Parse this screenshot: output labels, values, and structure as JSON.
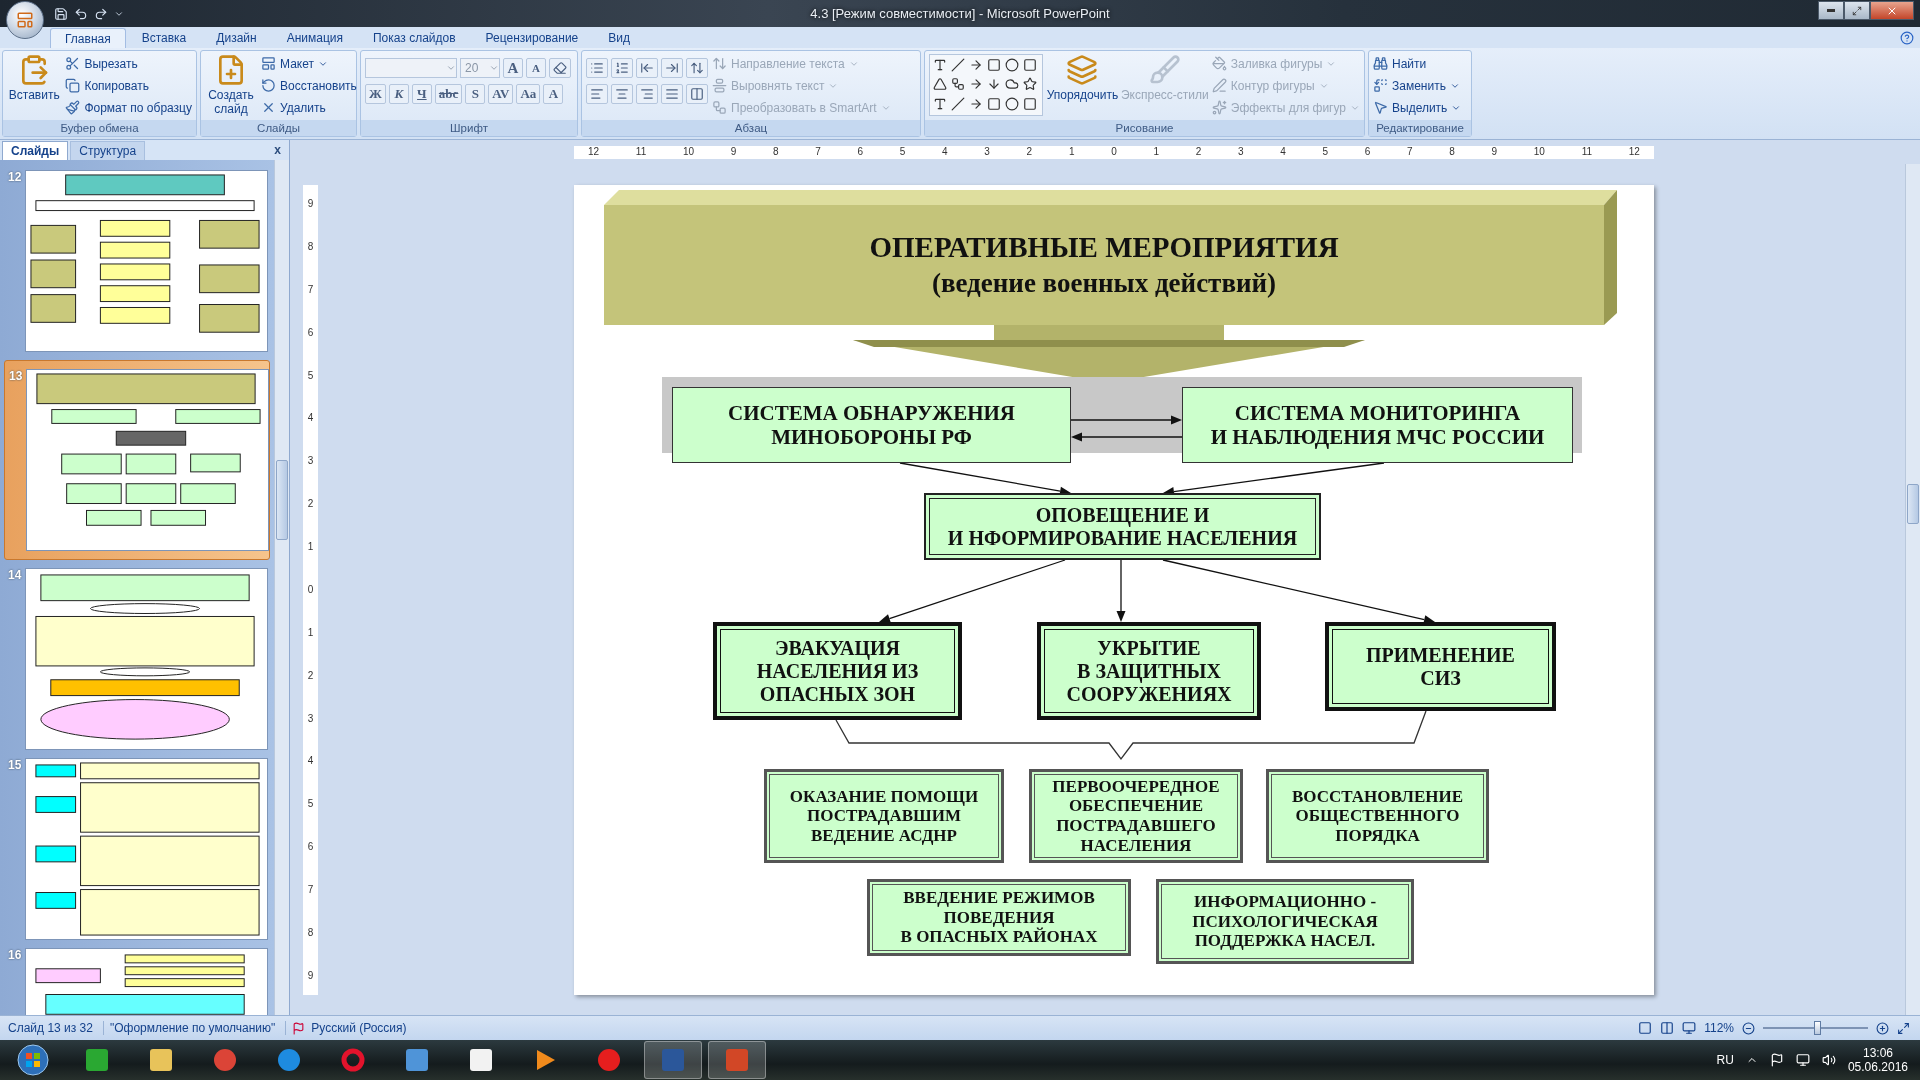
{
  "window": {
    "title": "4.3 [Режим совместимости] - Microsoft PowerPoint"
  },
  "ribbon": {
    "tabs": [
      {
        "label": "Главная",
        "selected": true
      },
      {
        "label": "Вставка",
        "selected": false
      },
      {
        "label": "Дизайн",
        "selected": false
      },
      {
        "label": "Анимация",
        "selected": false
      },
      {
        "label": "Показ слайдов",
        "selected": false
      },
      {
        "label": "Рецензирование",
        "selected": false
      },
      {
        "label": "Вид",
        "selected": false
      }
    ],
    "groups": [
      {
        "kind": "buttons",
        "title": "Буфер обмена",
        "large": [
          {
            "label": "Вставить",
            "disabled": false
          }
        ],
        "small": [
          {
            "label": "Вырезать",
            "disabled": false
          },
          {
            "label": "Копировать",
            "disabled": false
          },
          {
            "label": "Формат по образцу",
            "disabled": false
          }
        ]
      },
      {
        "kind": "buttons",
        "title": "Слайды",
        "large": [
          {
            "label": "Создать слайд",
            "disabled": false
          }
        ],
        "small": [
          {
            "label": "Макет",
            "disabled": false
          },
          {
            "label": "Восстановить",
            "disabled": false
          },
          {
            "label": "Удалить",
            "disabled": false
          }
        ]
      },
      {
        "kind": "font",
        "title": "Шрифт",
        "size_field": {
          "value": "20"
        },
        "size_buttons": [
          "A",
          "A"
        ],
        "format_buttons": [
          "Ж",
          "К",
          "Ч",
          "abc",
          "S",
          "AV",
          "Aa",
          "A"
        ]
      },
      {
        "kind": "paragraph",
        "title": "Абзац",
        "small": [
          {
            "label": "Направление текста",
            "disabled": true
          },
          {
            "label": "Выровнять текст",
            "disabled": true
          },
          {
            "label": "Преобразовать в SmartArt",
            "disabled": true
          }
        ]
      },
      {
        "kind": "drawing",
        "title": "Рисование",
        "large": [
          {
            "label": "Упорядочить",
            "disabled": false
          },
          {
            "label": "Экспресс-стили",
            "disabled": true
          }
        ],
        "small": [
          {
            "label": "Заливка фигуры",
            "disabled": true
          },
          {
            "label": "Контур фигуры",
            "disabled": true
          },
          {
            "label": "Эффекты для фигур",
            "disabled": true
          }
        ]
      },
      {
        "kind": "buttons",
        "title": "Редактирование",
        "small": [
          {
            "label": "Найти",
            "disabled": false
          },
          {
            "label": "Заменить",
            "disabled": false
          },
          {
            "label": "Выделить",
            "disabled": false
          }
        ]
      }
    ]
  },
  "panel": {
    "tabs": [
      {
        "label": "Слайды",
        "selected": true
      },
      {
        "label": "Структура",
        "selected": false
      }
    ],
    "close": "x",
    "thumbnails": [
      {
        "number": "12",
        "selected": false
      },
      {
        "number": "13",
        "selected": true
      },
      {
        "number": "14",
        "selected": false
      },
      {
        "number": "15",
        "selected": false
      },
      {
        "number": "16",
        "selected": false
      }
    ]
  },
  "ruler": {
    "horizontal": [
      "12",
      "11",
      "10",
      "9",
      "8",
      "7",
      "6",
      "5",
      "4",
      "3",
      "2",
      "1",
      "0",
      "1",
      "2",
      "3",
      "4",
      "5",
      "6",
      "7",
      "8",
      "9",
      "10",
      "11",
      "12"
    ],
    "vertical": [
      "9",
      "8",
      "7",
      "6",
      "5",
      "4",
      "3",
      "2",
      "1",
      "0",
      "1",
      "2",
      "3",
      "4",
      "5",
      "6",
      "7",
      "8",
      "9"
    ]
  },
  "slide": {
    "title": "ОПЕРАТИВНЫЕ МЕРОПРИЯТИЯ",
    "subtitle": "(ведение военных действий)",
    "nodes": [
      {
        "kind": "source",
        "lines": [
          "СИСТЕМА ОБНАРУЖЕНИЯ",
          "МИНОБОРОНЫ РФ"
        ]
      },
      {
        "kind": "source",
        "lines": [
          "СИСТЕМА МОНИТОРИНГА",
          "И НАБЛЮДЕНИЯ МЧС РОССИИ"
        ]
      },
      {
        "kind": "hub",
        "lines": [
          "ОПОВЕЩЕНИЕ И",
          "И НФОРМИРОВАНИЕ НАСЕЛЕНИЯ"
        ]
      },
      {
        "kind": "action",
        "lines": [
          "ЭВАКУАЦИЯ",
          "НАСЕЛЕНИЯ ИЗ",
          "ОПАСНЫХ ЗОН"
        ]
      },
      {
        "kind": "action",
        "lines": [
          "УКРЫТИЕ",
          "В ЗАЩИТНЫХ",
          "СООРУЖЕНИЯХ"
        ]
      },
      {
        "kind": "action",
        "lines": [
          "ПРИМЕНЕНИЕ",
          "СИЗ"
        ]
      },
      {
        "kind": "task",
        "lines": [
          "ОКАЗАНИЕ ПОМОЩИ",
          "ПОСТРАДАВШИМ",
          "ВЕДЕНИЕ АСДНР"
        ]
      },
      {
        "kind": "task",
        "lines": [
          "ПЕРВООЧЕРЕДНОЕ",
          "ОБЕСПЕЧЕНИЕ",
          "ПОСТРАДАВШЕГО",
          "НАСЕЛЕНИЯ"
        ]
      },
      {
        "kind": "task",
        "lines": [
          "ВОССТАНОВЛЕНИЕ",
          "ОБЩЕСТВЕННОГО",
          "ПОРЯДКА"
        ]
      },
      {
        "kind": "task",
        "lines": [
          "ВВЕДЕНИЕ РЕЖИМОВ",
          "ПОВЕДЕНИЯ",
          "В ОПАСНЫХ РАЙОНАХ"
        ]
      },
      {
        "kind": "task",
        "lines": [
          "ИНФОРМАЦИОННО -",
          "ПСИХОЛОГИЧЕСКАЯ",
          "ПОДДЕРЖКА НАСЕЛ."
        ]
      }
    ]
  },
  "status_bar": {
    "slide": "Слайд 13 из 32",
    "theme": "\"Оформление по умолчанию\"",
    "language": "Русский (Россия)",
    "zoom": {
      "value": "112%",
      "level": 0.52
    }
  },
  "taskbar": {
    "language": "RU",
    "time": "13:06",
    "date": "05.06.2016"
  }
}
